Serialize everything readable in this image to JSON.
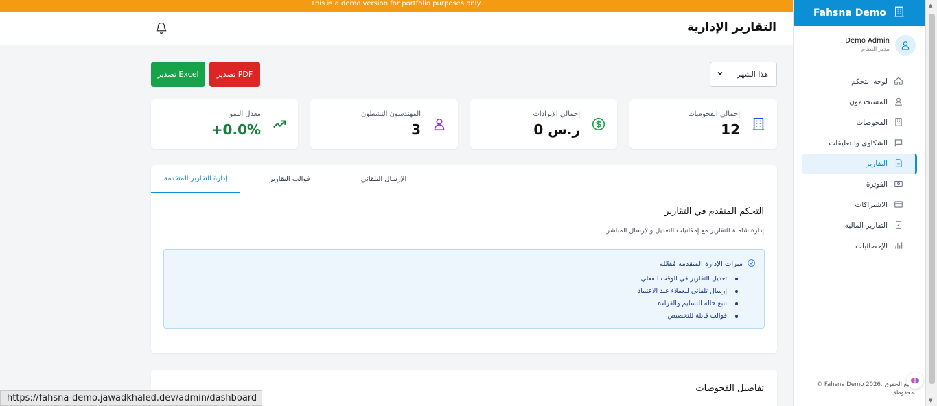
{
  "banner": {
    "text": "This is a demo version for portfolio purposes only."
  },
  "sidebar": {
    "brand": "Fahsna Demo",
    "brand_icon": "building-icon",
    "user": {
      "name": "Demo Admin",
      "role": "مدير النظام"
    },
    "items": [
      {
        "label": "لوحة التحكم",
        "icon": "home-icon"
      },
      {
        "label": "المستخدمون",
        "icon": "user-icon"
      },
      {
        "label": "الفحوصات",
        "icon": "building-icon"
      },
      {
        "label": "الشكاوى والتعليقات",
        "icon": "chat-icon"
      },
      {
        "label": "التقارير",
        "icon": "document-icon",
        "active": true
      },
      {
        "label": "الفوترة",
        "icon": "invoice-icon"
      },
      {
        "label": "الاشتراكات",
        "icon": "card-icon"
      },
      {
        "label": "التقارير المالية",
        "icon": "finance-report-icon"
      },
      {
        "label": "الإحصائيات",
        "icon": "bar-chart-icon"
      }
    ],
    "footer": "© Fahsna Demo 2026. جميع الحقوق محفوظة."
  },
  "header": {
    "title": "التقارير الإدارية"
  },
  "toolbar": {
    "period": "هذا الشهر",
    "export_pdf": "تصدير PDF",
    "export_excel": "تصدير Excel"
  },
  "stats": [
    {
      "label": "إجمالي الفحوصات",
      "value": "12",
      "icon": "building-icon",
      "color": "#1d4ed8"
    },
    {
      "label": "إجمالي الإيرادات",
      "value": "0 ر.س",
      "icon": "dollar-icon",
      "color": "#16a34a"
    },
    {
      "label": "المهندسون النشطون",
      "value": "3",
      "icon": "user-icon",
      "color": "#9333ea"
    },
    {
      "label": "معدل النمو",
      "value": "+0.0%",
      "icon": "trend-up-icon",
      "color": "#15803d"
    }
  ],
  "tabs": [
    {
      "label": "إدارة التقارير المتقدمة",
      "active": true
    },
    {
      "label": "قوالب التقارير"
    },
    {
      "label": "الإرسال التلقائي"
    }
  ],
  "panel": {
    "title": "التحكم المتقدم في التقارير",
    "subtitle": "إدارة شاملة للتقارير مع إمكانيات التعديل والإرسال المباشر",
    "info_title": "ميزات الإدارة المتقدمة مُفعّلة",
    "features": [
      "تعديل التقارير في الوقت الفعلي",
      "إرسال تلقائي للعملاء عند الاعتماد",
      "تتبع حالة التسليم والقراءة",
      "قوالب قابلة للتخصيص"
    ]
  },
  "section2": {
    "title": "تفاصيل الفحوصات"
  },
  "status_url": "https://fahsna-demo.jawadkhaled.dev/admin/dashboard",
  "colors": {
    "accent": "#0d8fd6",
    "banner": "#f39c12",
    "pdf": "#dc2626",
    "excel": "#16a34a"
  }
}
